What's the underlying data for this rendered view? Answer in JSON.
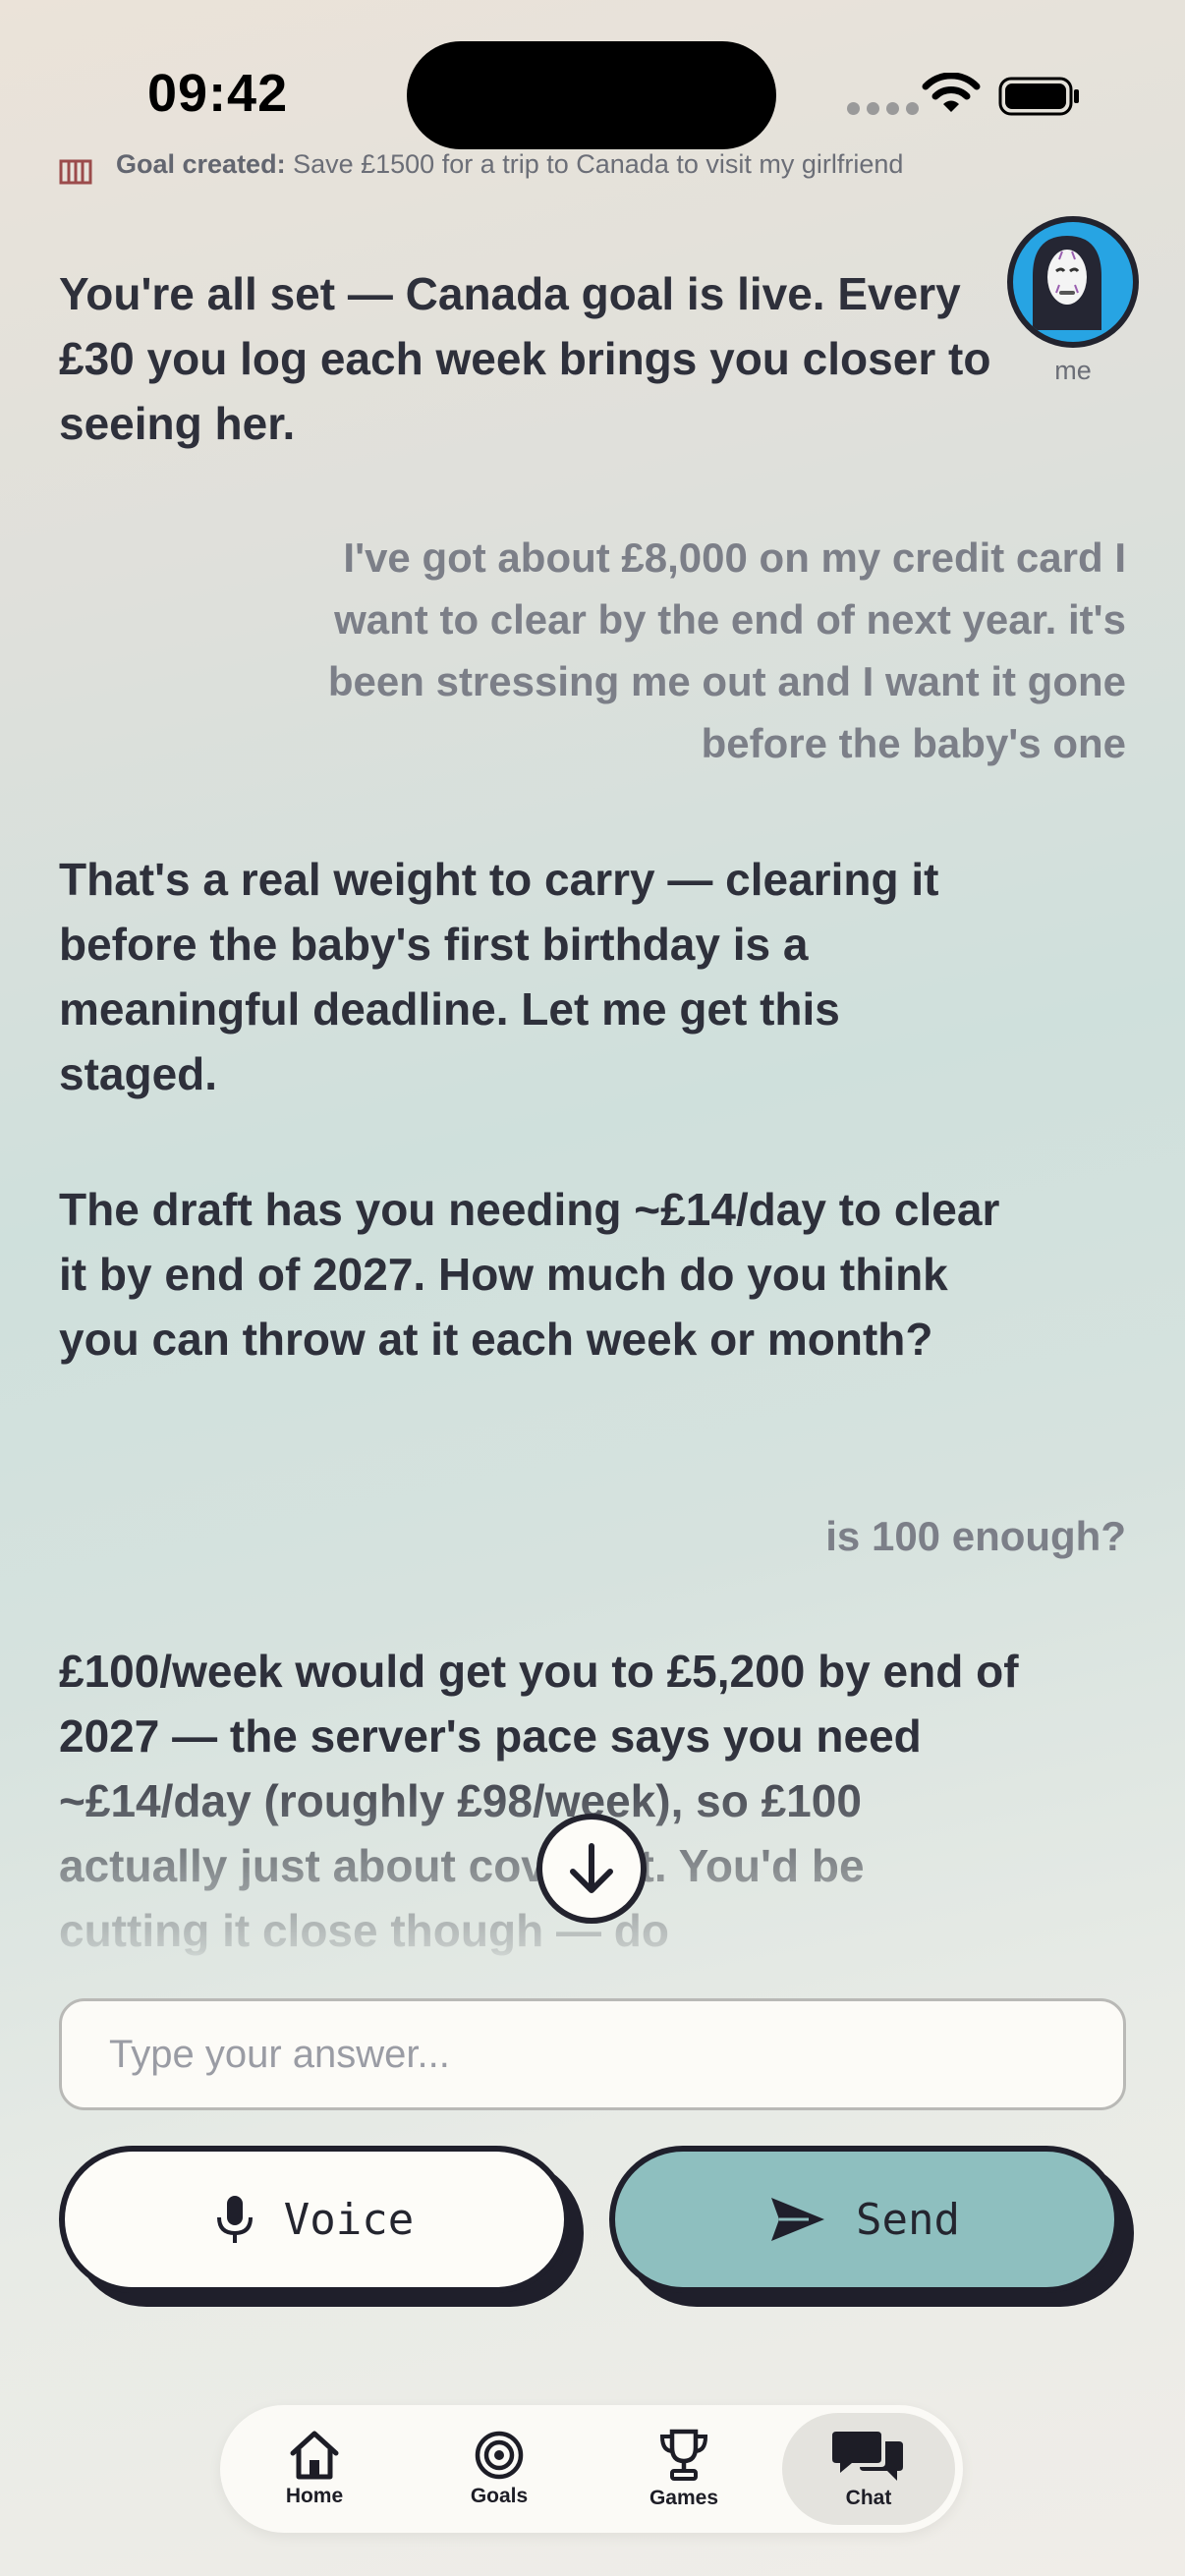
{
  "status_bar": {
    "time": "09:42"
  },
  "goal_notice": {
    "icon": "gate-icon",
    "label": "Goal created:",
    "text": "Save £1500 for a trip to Canada to visit my girlfriend"
  },
  "avatar": {
    "label": "me",
    "color": "#27a4e3"
  },
  "messages": [
    {
      "role": "bot",
      "text": "You're all set — Canada goal is live. Every £30 you log each week brings you closer to seeing her."
    },
    {
      "role": "user",
      "text": "I've got about £8,000 on my credit card I want to clear by the end of next year. it's been stressing me out and I want it gone before the baby's one"
    },
    {
      "role": "bot",
      "text": "That's a real weight to carry — clearing it before the baby's first birthday is a meaningful deadline. Let me get this staged."
    },
    {
      "role": "bot",
      "text": "The draft has you needing ~£14/day to clear it by end of 2027. How much do you think you can throw at it each week or month?"
    },
    {
      "role": "user",
      "text": "is 100 enough?"
    },
    {
      "role": "bot",
      "text": "£100/week would get you to £5,200 by end of 2027 — the server's pace says you need ~£14/day (roughly £98/week), so £100 actually just about covers it. You'd be cutting it close though — do"
    }
  ],
  "input": {
    "placeholder": "Type your answer..."
  },
  "buttons": {
    "voice": "Voice",
    "send": "Send"
  },
  "colors": {
    "send": "#8ebfbf",
    "ink": "#1f1f2b",
    "text": "#2e303b",
    "muted": "#7c7f88"
  },
  "tabs": [
    {
      "label": "Home",
      "icon": "home-icon"
    },
    {
      "label": "Goals",
      "icon": "target-icon"
    },
    {
      "label": "Games",
      "icon": "trophy-icon"
    },
    {
      "label": "Chat",
      "icon": "chat-bubbles-icon",
      "active": true
    }
  ]
}
